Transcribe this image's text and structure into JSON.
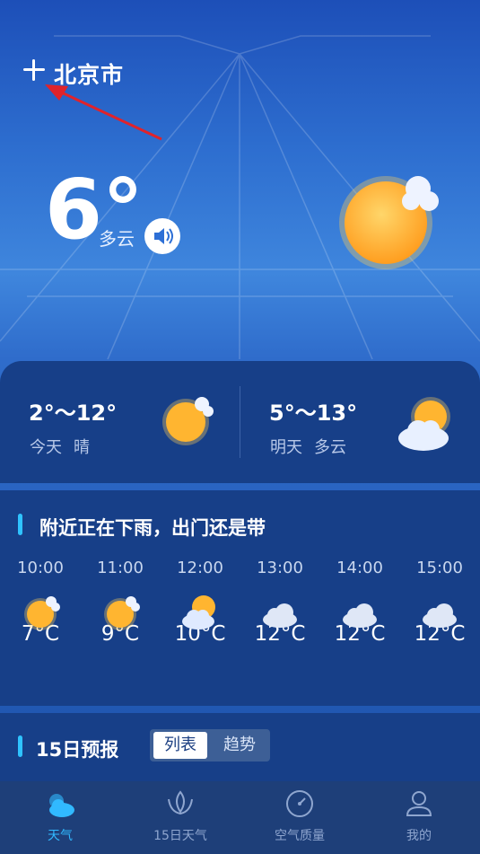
{
  "header": {
    "city": "北京市"
  },
  "current": {
    "temperature": "6°",
    "condition": "多云"
  },
  "forecast": {
    "today": {
      "range": "2°～12°",
      "day": "今天",
      "condition": "晴"
    },
    "tomorrow": {
      "range": "5°～13°",
      "day": "明天",
      "condition": "多云"
    }
  },
  "hourly": {
    "title": "附近正在下雨，出门还是带",
    "items": [
      {
        "time": "10:00",
        "temp": "7°C",
        "icon": "sun-cloud-icon"
      },
      {
        "time": "11:00",
        "temp": "9°C",
        "icon": "sun-cloud-icon"
      },
      {
        "time": "12:00",
        "temp": "10°C",
        "icon": "partly-cloudy-icon"
      },
      {
        "time": "13:00",
        "temp": "12°C",
        "icon": "cloud-icon"
      },
      {
        "time": "14:00",
        "temp": "12°C",
        "icon": "cloud-icon"
      },
      {
        "time": "15:00",
        "temp": "12°C",
        "icon": "cloud-icon"
      }
    ]
  },
  "fifteen_day": {
    "title": "15日预报",
    "toggle": {
      "list": "列表",
      "trend": "趋势"
    }
  },
  "tabs": {
    "weather": "天气",
    "days15": "15日天气",
    "air": "空气质量",
    "mine": "我的"
  },
  "colors": {
    "accent": "#31b9ff",
    "card": "#173f88",
    "sun": "#ffb02e"
  }
}
